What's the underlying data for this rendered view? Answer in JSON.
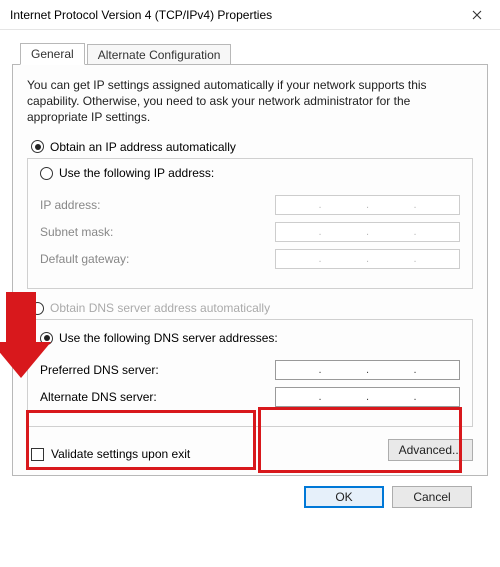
{
  "window": {
    "title": "Internet Protocol Version 4 (TCP/IPv4) Properties"
  },
  "tabs": {
    "general": "General",
    "alternate": "Alternate Configuration"
  },
  "intro": "You can get IP settings assigned automatically if your network supports this capability. Otherwise, you need to ask your network administrator for the appropriate IP settings.",
  "ip_section": {
    "radio_auto": "Obtain an IP address automatically",
    "radio_manual": "Use the following IP address:",
    "ip_address_label": "IP address:",
    "subnet_label": "Subnet mask:",
    "gateway_label": "Default gateway:"
  },
  "dns_section": {
    "radio_auto": "Obtain DNS server address automatically",
    "radio_manual": "Use the following DNS server addresses:",
    "preferred_label": "Preferred DNS server:",
    "alternate_label": "Alternate DNS server:"
  },
  "validate_label": "Validate settings upon exit",
  "buttons": {
    "advanced": "Advanced...",
    "ok": "OK",
    "cancel": "Cancel"
  }
}
